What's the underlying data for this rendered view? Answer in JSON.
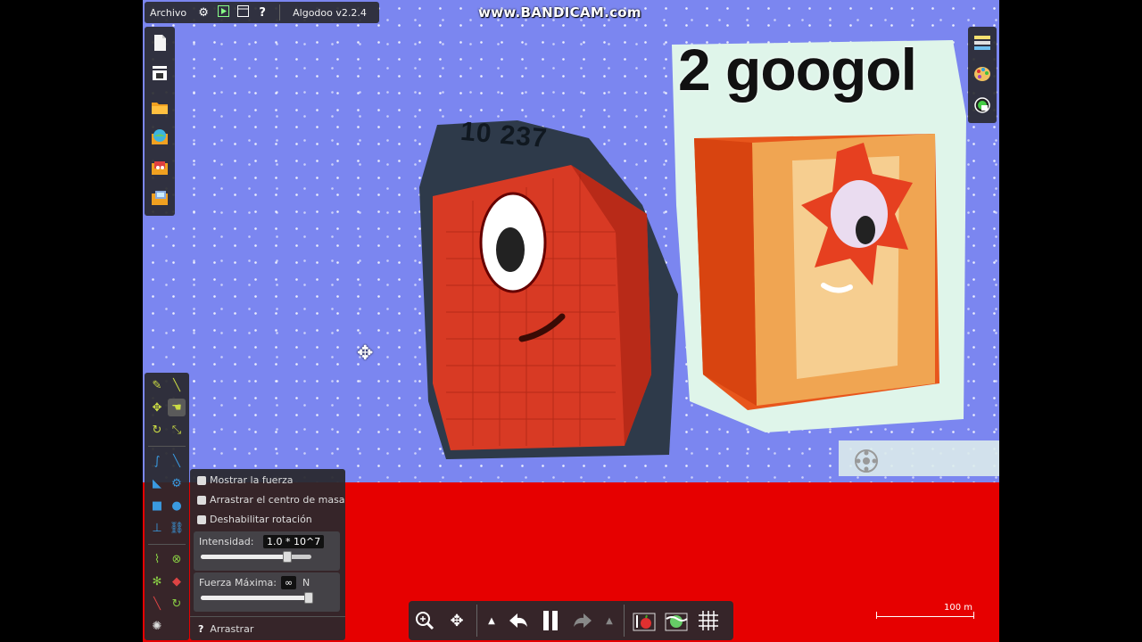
{
  "watermark": "www.BANDICAM.com",
  "topbar": {
    "menu_label": "Archivo",
    "version": "Algodoo v2.2.4",
    "icons": [
      "gear-icon",
      "play-scene-icon",
      "window-icon",
      "help-icon"
    ],
    "help_glyph": "?"
  },
  "scene": {
    "left_character_label": "10^237",
    "left_character_label_text": "10 237",
    "right_character_title": "2 googol"
  },
  "options_panel": {
    "checkboxes": [
      {
        "label": "Mostrar la  fuerza",
        "checked": false
      },
      {
        "label": "Arrastrar el centro de masa",
        "checked": false
      },
      {
        "label": "Deshabilitar rotación",
        "checked": false
      }
    ],
    "intensity": {
      "label": "Intensidad:",
      "value": "1.0 * 10^7",
      "slider_fraction": 0.8
    },
    "max_force": {
      "label": "Fuerza Máxima:",
      "value": "∞",
      "unit": "N",
      "slider_fraction": 1.0
    },
    "help_glyph": "?",
    "tool_name": "Arrastrar"
  },
  "playbar": {
    "buttons": [
      "zoom-icon",
      "pan-icon",
      "step-back-icon",
      "undo-icon",
      "pause-icon",
      "redo-icon",
      "step-forward-icon",
      "gravity-apple-icon",
      "air-friction-icon",
      "grid-icon"
    ]
  },
  "scale": {
    "label": "100 m"
  },
  "colors": {
    "sky": "#7b86f0",
    "ground": "#e60000",
    "panel": "#28282c"
  }
}
